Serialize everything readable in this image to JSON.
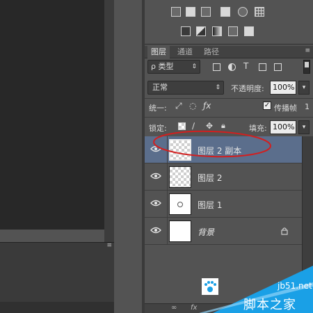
{
  "adjustments": {
    "row1_icons": [
      "levels-icon",
      "curves-icon",
      "balance-icon",
      "exposure-icon",
      "channel-mixer-icon",
      "color-lookup-icon"
    ],
    "row2_icons": [
      "posterize-icon",
      "threshold-icon",
      "gradient-map-icon",
      "selective-color-icon",
      "invert-icon"
    ]
  },
  "panel": {
    "tabs": [
      "图层",
      "通道",
      "路径"
    ],
    "active_tab": 0,
    "menu_icon": "≡",
    "filter_label": "ρ 类型",
    "blend_mode": "正常",
    "opacity_label": "不透明度:",
    "opacity_value": "100%",
    "unify_label": "统一:",
    "propagate_label": "传播帧",
    "propagate_value": "1",
    "lock_label": "锁定:",
    "fill_label": "填充:",
    "fill_value": "100%"
  },
  "layers": [
    {
      "name": "图层 2 副本",
      "thumbnail": "transparent",
      "selected": true,
      "locked": false,
      "italic": false
    },
    {
      "name": "图层 2",
      "thumbnail": "transparent",
      "selected": false,
      "locked": false,
      "italic": false
    },
    {
      "name": "图层 1",
      "thumbnail": "small-object",
      "selected": false,
      "locked": false,
      "italic": false
    },
    {
      "name": "背景",
      "thumbnail": "white",
      "selected": false,
      "locked": true,
      "italic": true
    }
  ],
  "watermark": {
    "domain": "jb51.net",
    "name": "脚本之家"
  },
  "colors": {
    "panel_bg": "#535353",
    "selected_row": "#5b6e8c",
    "annotation": "#d21f1f",
    "watermark_blue": "#1aa0e6"
  }
}
